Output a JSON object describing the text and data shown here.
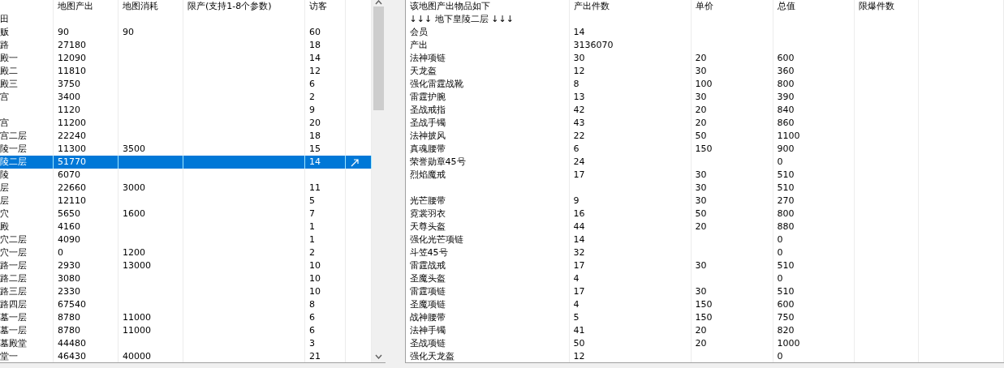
{
  "map_table": {
    "columns": [
      "地图产出",
      "地图消耗",
      "限产(支持1-8个参数)",
      "访客"
    ],
    "rows": [
      {
        "name": "田",
        "output": "",
        "cost": "",
        "limit": "",
        "visitors": "",
        "selected": false
      },
      {
        "name": "贩",
        "output": "90",
        "cost": "90",
        "limit": "",
        "visitors": "60",
        "selected": false
      },
      {
        "name": "路",
        "output": "27180",
        "cost": "",
        "limit": "",
        "visitors": "18",
        "selected": false
      },
      {
        "name": "殿一",
        "output": "12090",
        "cost": "",
        "limit": "",
        "visitors": "14",
        "selected": false
      },
      {
        "name": "殿二",
        "output": "11810",
        "cost": "",
        "limit": "",
        "visitors": "12",
        "selected": false
      },
      {
        "name": "殿三",
        "output": "3750",
        "cost": "",
        "limit": "",
        "visitors": "6",
        "selected": false
      },
      {
        "name": "宫",
        "output": "3400",
        "cost": "",
        "limit": "",
        "visitors": "2",
        "selected": false
      },
      {
        "name": "",
        "output": "1120",
        "cost": "",
        "limit": "",
        "visitors": "9",
        "selected": false
      },
      {
        "name": "宫",
        "output": "11200",
        "cost": "",
        "limit": "",
        "visitors": "20",
        "selected": false
      },
      {
        "name": "宫二层",
        "output": "22240",
        "cost": "",
        "limit": "",
        "visitors": "18",
        "selected": false
      },
      {
        "name": "陵一层",
        "output": "11300",
        "cost": "3500",
        "limit": "",
        "visitors": "15",
        "selected": false
      },
      {
        "name": "陵二层",
        "output": "51770",
        "cost": "",
        "limit": "",
        "visitors": "14",
        "selected": true
      },
      {
        "name": "陵",
        "output": "6070",
        "cost": "",
        "limit": "",
        "visitors": "",
        "selected": false
      },
      {
        "name": "层",
        "output": "22660",
        "cost": "3000",
        "limit": "",
        "visitors": "11",
        "selected": false
      },
      {
        "name": "层",
        "output": "12110",
        "cost": "",
        "limit": "",
        "visitors": "5",
        "selected": false
      },
      {
        "name": "穴",
        "output": "5650",
        "cost": "1600",
        "limit": "",
        "visitors": "7",
        "selected": false
      },
      {
        "name": "殿",
        "output": "4160",
        "cost": "",
        "limit": "",
        "visitors": "1",
        "selected": false
      },
      {
        "name": "穴二层",
        "output": "4090",
        "cost": "",
        "limit": "",
        "visitors": "1",
        "selected": false
      },
      {
        "name": "穴一层",
        "output": "0",
        "cost": "1200",
        "limit": "",
        "visitors": "2",
        "selected": false
      },
      {
        "name": "路一层",
        "output": "2930",
        "cost": "13000",
        "limit": "",
        "visitors": "10",
        "selected": false
      },
      {
        "name": "路二层",
        "output": "3080",
        "cost": "",
        "limit": "",
        "visitors": "10",
        "selected": false
      },
      {
        "name": "路三层",
        "output": "2330",
        "cost": "",
        "limit": "",
        "visitors": "10",
        "selected": false
      },
      {
        "name": "路四层",
        "output": "67540",
        "cost": "",
        "limit": "",
        "visitors": "8",
        "selected": false
      },
      {
        "name": "墓一层",
        "output": "8780",
        "cost": "11000",
        "limit": "",
        "visitors": "6",
        "selected": false
      },
      {
        "name": "墓一层",
        "output": "8780",
        "cost": "11000",
        "limit": "",
        "visitors": "6",
        "selected": false
      },
      {
        "name": "墓殿堂",
        "output": "44480",
        "cost": "",
        "limit": "",
        "visitors": "3",
        "selected": false
      },
      {
        "name": "堂一",
        "output": "46430",
        "cost": "40000",
        "limit": "",
        "visitors": "21",
        "selected": false
      }
    ]
  },
  "item_table": {
    "columns": [
      "该地图产出物品如下",
      "产出件数",
      "单价",
      "总值",
      "限爆件数"
    ],
    "heading": "↓↓↓ 地下皇陵二层 ↓↓↓",
    "rows": [
      {
        "name": "会员",
        "count": "14",
        "price": "",
        "total": ""
      },
      {
        "name": "产出",
        "count": "3136070",
        "price": "",
        "total": ""
      },
      {
        "name": "法神项链",
        "count": "30",
        "price": "20",
        "total": "600"
      },
      {
        "name": "天龙盔",
        "count": "12",
        "price": "30",
        "total": "360"
      },
      {
        "name": "强化雷霆战靴",
        "count": "8",
        "price": "100",
        "total": "800"
      },
      {
        "name": "雷霆护腕",
        "count": "13",
        "price": "30",
        "total": "390"
      },
      {
        "name": "圣战戒指",
        "count": "42",
        "price": "20",
        "total": "840"
      },
      {
        "name": "圣战手镯",
        "count": "43",
        "price": "20",
        "total": "860"
      },
      {
        "name": "法神披风",
        "count": "22",
        "price": "50",
        "total": "1100"
      },
      {
        "name": "真魂腰带",
        "count": "6",
        "price": "150",
        "total": "900"
      },
      {
        "name": "荣誉勋章45号",
        "count": "24",
        "price": "",
        "total": "0"
      },
      {
        "name": "烈焰魔戒",
        "count": "17",
        "price": "30",
        "total": "510"
      },
      {
        "name": "",
        "count": "",
        "price": "30",
        "total": "510"
      },
      {
        "name": "光芒腰带",
        "count": "9",
        "price": "30",
        "total": "270"
      },
      {
        "name": "霓裳羽衣",
        "count": "16",
        "price": "50",
        "total": "800"
      },
      {
        "name": "天尊头盔",
        "count": "44",
        "price": "20",
        "total": "880"
      },
      {
        "name": "强化光芒项链",
        "count": "14",
        "price": "",
        "total": "0"
      },
      {
        "name": "斗笠45号",
        "count": "32",
        "price": "",
        "total": "0"
      },
      {
        "name": "雷霆战戒",
        "count": "17",
        "price": "30",
        "total": "510"
      },
      {
        "name": "圣魔头盔",
        "count": "4",
        "price": "",
        "total": "0"
      },
      {
        "name": "雷霆项链",
        "count": "17",
        "price": "30",
        "total": "510"
      },
      {
        "name": "圣魔项链",
        "count": "4",
        "price": "150",
        "total": "600"
      },
      {
        "name": "战神腰带",
        "count": "5",
        "price": "150",
        "total": "750"
      },
      {
        "name": "法神手镯",
        "count": "41",
        "price": "20",
        "total": "820"
      },
      {
        "name": "圣战项链",
        "count": "50",
        "price": "20",
        "total": "1000"
      },
      {
        "name": "强化天龙盔",
        "count": "12",
        "price": "",
        "total": "0"
      }
    ]
  }
}
